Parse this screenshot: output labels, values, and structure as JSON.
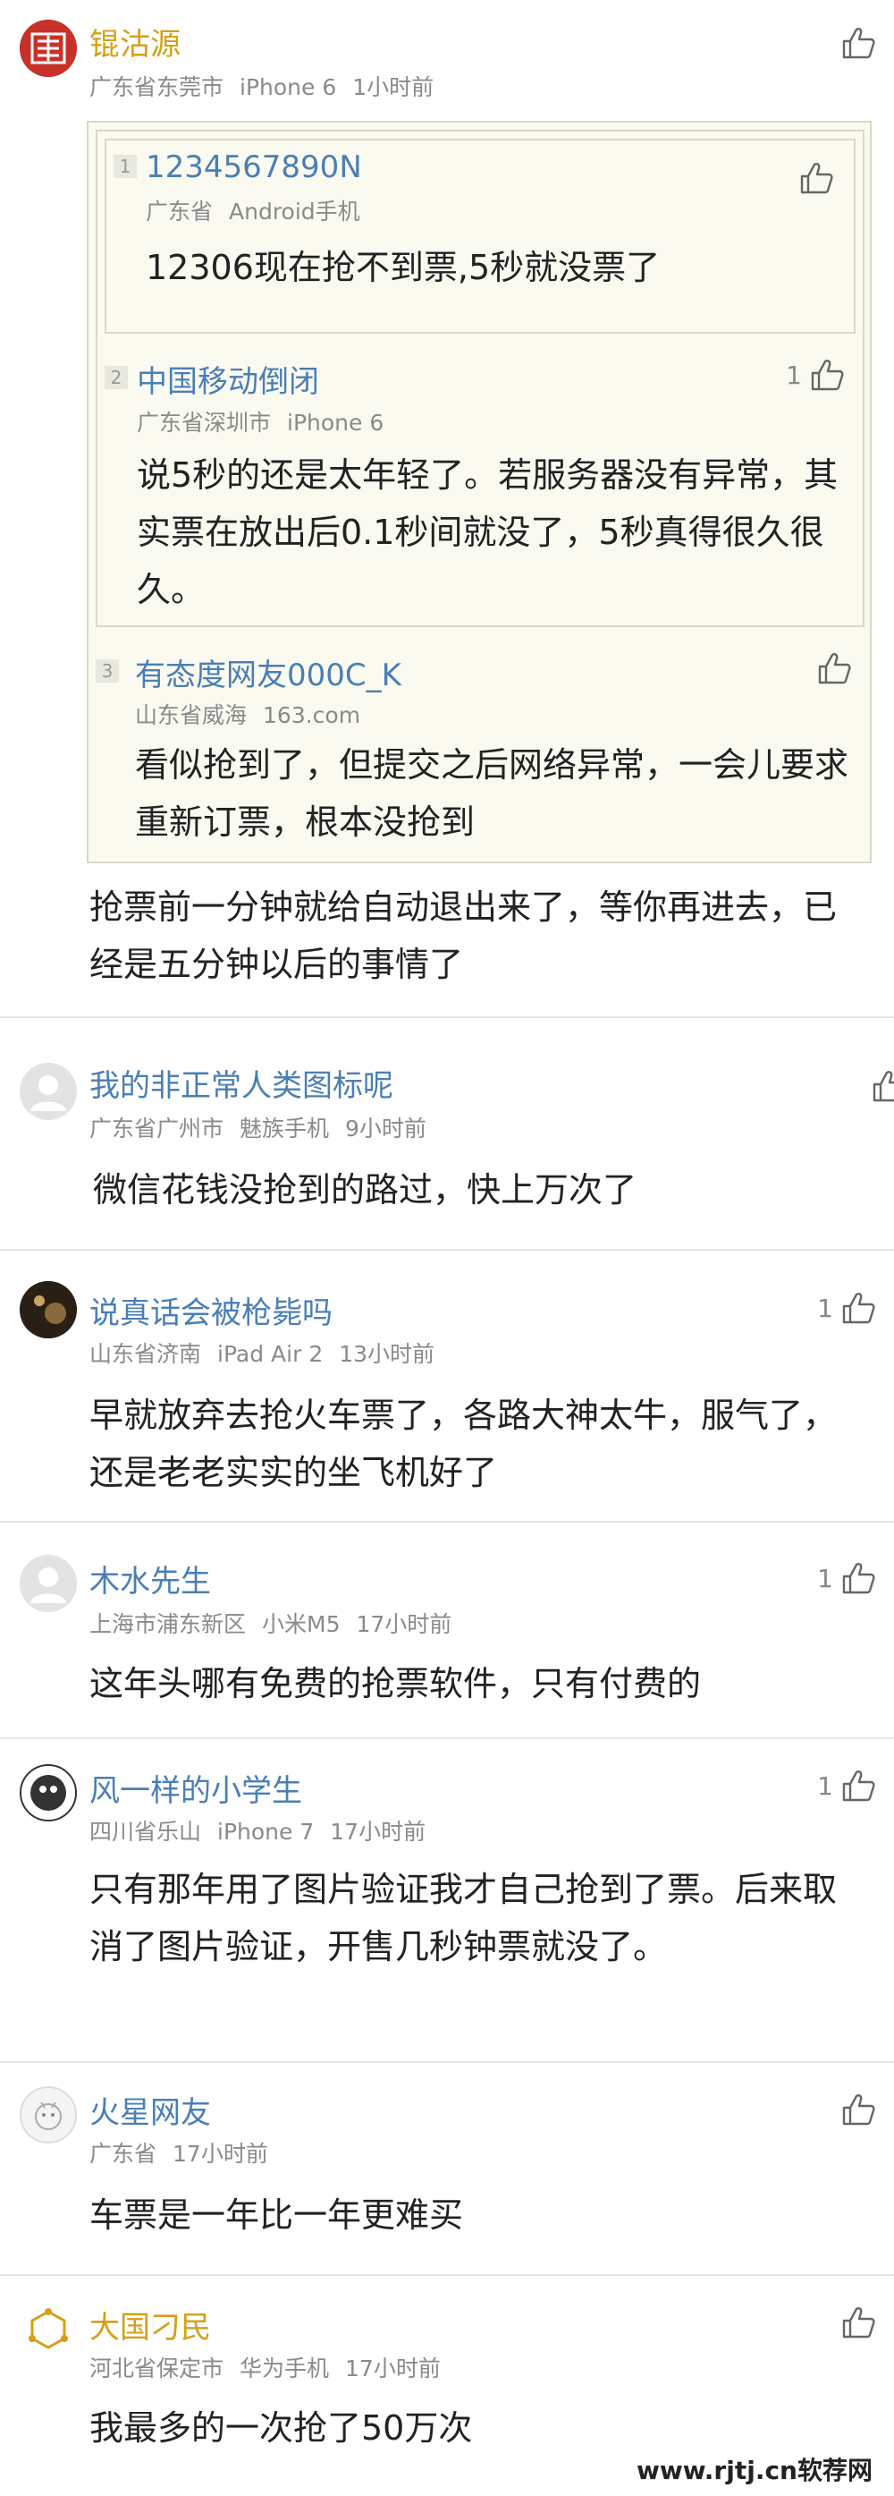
{
  "comments": [
    {
      "name": "锟沽源",
      "location": "广东省东莞市",
      "device": "iPhone 6",
      "time": "1小时前",
      "likes": "",
      "text": "抢票前一分钟就给自动退出来了，等你再进去，已经是五分钟以后的事情了",
      "floors": [
        {
          "num": "1",
          "name": "1234567890N",
          "location": "广东省",
          "device": "Android手机",
          "likes": "",
          "text": "12306现在抢不到票,5秒就没票了"
        },
        {
          "num": "2",
          "name": "中国移动倒闭",
          "location": "广东省深圳市",
          "device": "iPhone 6",
          "likes": "1",
          "text": "说5秒的还是太年轻了。若服务器没有异常，其实票在放出后0.1秒间就没了，5秒真得很久很久。"
        },
        {
          "num": "3",
          "name": "有态度网友000C_K",
          "location": "山东省威海",
          "device": "163.com",
          "likes": "",
          "text": "看似抢到了，但提交之后网络异常，一会儿要求重新订票，根本没抢到"
        }
      ]
    },
    {
      "name": "我的非正常人类图标呢",
      "location": "广东省广州市",
      "device": "魅族手机",
      "time": "9小时前",
      "likes": "",
      "text": "微信花钱没抢到的路过，快上万次了"
    },
    {
      "name": "说真话会被枪毙吗",
      "location": "山东省济南",
      "device": "iPad Air 2",
      "time": "13小时前",
      "likes": "1",
      "text": "早就放弃去抢火车票了，各路大神太牛，服气了，还是老老实实的坐飞机好了"
    },
    {
      "name": "木水先生",
      "location": "上海市浦东新区",
      "device": "小米M5",
      "time": "17小时前",
      "likes": "1",
      "text": "这年头哪有免费的抢票软件，只有付费的"
    },
    {
      "name": "风一样的小学生",
      "location": "四川省乐山",
      "device": "iPhone 7",
      "time": "17小时前",
      "likes": "1",
      "text": "只有那年用了图片验证我才自己抢到了票。后来取消了图片验证，开售几秒钟票就没了。"
    },
    {
      "name": "火星网友",
      "location": "广东省",
      "device": "",
      "time": "17小时前",
      "likes": "",
      "text": "车票是一年比一年更难买"
    },
    {
      "name": "大国刁民",
      "location": "河北省保定市",
      "device": "华为手机",
      "time": "17小时前",
      "likes": "",
      "text": "我最多的一次抢了50万次"
    }
  ],
  "watermark": "www.rjtj.cn软荐网",
  "colors": {
    "name": "#4a7fb5",
    "gold_name": "#d4a017",
    "meta": "#8a8a8a",
    "floor_bg": "#fbfaf1",
    "floor_border": "#d9d7c6"
  }
}
